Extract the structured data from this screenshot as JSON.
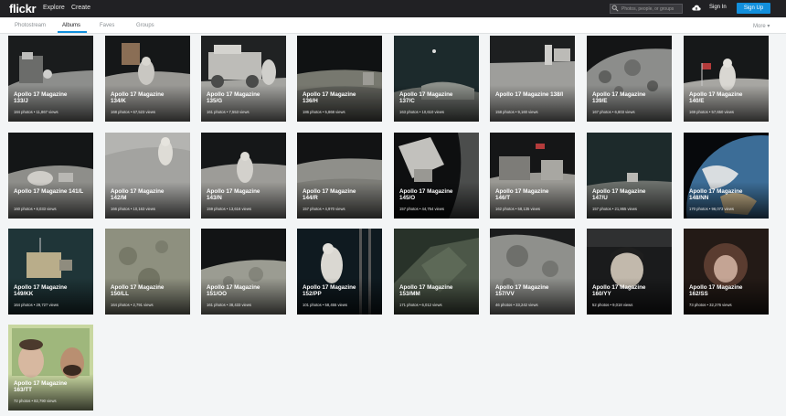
{
  "header": {
    "logo": "flickr",
    "nav": [
      "Explore",
      "Create"
    ],
    "search_placeholder": "Photos, people, or groups",
    "sign_in": "Sign In",
    "sign_up": "Sign Up"
  },
  "subnav": {
    "tabs": [
      "Photostream",
      "Albums",
      "Faves",
      "Groups"
    ],
    "active_tab": "Albums",
    "more": "More ▾"
  },
  "albums": [
    {
      "line1": "Apollo 17 Magazine",
      "line2": "133/J",
      "stats": "184 photos  •  11,867 views"
    },
    {
      "line1": "Apollo 17 Magazine",
      "line2": "134/K",
      "stats": "168 photos  •  67,523 views"
    },
    {
      "line1": "Apollo 17 Magazine",
      "line2": "135/G",
      "stats": "161 photos  •  7,553 views"
    },
    {
      "line1": "Apollo 17 Magazine",
      "line2": "136/H",
      "stats": "186 photos  •  5,868 views"
    },
    {
      "line1": "Apollo 17 Magazine",
      "line2": "137/C",
      "stats": "163 photos  •  10,610 views"
    },
    {
      "line1": "Apollo 17 Magazine 138/I",
      "line2": "",
      "stats": "158 photos  •  9,160 views"
    },
    {
      "line1": "Apollo 17 Magazine",
      "line2": "139/E",
      "stats": "167 photos  •  6,803 views"
    },
    {
      "line1": "Apollo 17 Magazine",
      "line2": "140/E",
      "stats": "169 photos  •  57,650 views"
    },
    {
      "line1": "Apollo 17 Magazine 141/L",
      "line2": "",
      "stats": "160 photos  •  8,033 views"
    },
    {
      "line1": "Apollo 17 Magazine",
      "line2": "142/M",
      "stats": "166 photos  •  10,163 views"
    },
    {
      "line1": "Apollo 17 Magazine",
      "line2": "143/N",
      "stats": "159 photos  •  13,616 views"
    },
    {
      "line1": "Apollo 17 Magazine",
      "line2": "144/R",
      "stats": "157 photos  •  4,970 views"
    },
    {
      "line1": "Apollo 17 Magazine",
      "line2": "145/O",
      "stats": "157 photos  •  44,754 views"
    },
    {
      "line1": "Apollo 17 Magazine",
      "line2": "146/T",
      "stats": "162 photos  •  58,135 views"
    },
    {
      "line1": "Apollo 17 Magazine",
      "line2": "147/U",
      "stats": "157 photos  •  21,865 views"
    },
    {
      "line1": "Apollo 17 Magazine",
      "line2": "148/NN",
      "stats": "170 photos  •  96,073 views"
    },
    {
      "line1": "Apollo 17 Magazine",
      "line2": "149/KK",
      "stats": "164 photos  •  29,727 views"
    },
    {
      "line1": "Apollo 17 Magazine",
      "line2": "150/LL",
      "stats": "164 photos  •  2,791 views"
    },
    {
      "line1": "Apollo 17 Magazine",
      "line2": "151/OO",
      "stats": "161 photos  •  38,433 views"
    },
    {
      "line1": "Apollo 17 Magazine",
      "line2": "152/PP",
      "stats": "101 photos  •  58,455 views"
    },
    {
      "line1": "Apollo 17 Magazine",
      "line2": "153/MM",
      "stats": "171 photos  •  6,012 views"
    },
    {
      "line1": "Apollo 17 Magazine",
      "line2": "157/VV",
      "stats": "46 photos  •  33,242 views"
    },
    {
      "line1": "Apollo 17 Magazine",
      "line2": "160/YY",
      "stats": "52 photos  •  9,018 views"
    },
    {
      "line1": "Apollo 17 Magazine",
      "line2": "162/SS",
      "stats": "73 photos  •  32,276 views"
    },
    {
      "line1": "Apollo 17 Magazine",
      "line2": "163/TT",
      "stats": "72 photos  •  82,790 views"
    }
  ],
  "colors": {
    "topbar": "#212124",
    "accent": "#128fdc",
    "page_bg": "#f3f5f6"
  }
}
